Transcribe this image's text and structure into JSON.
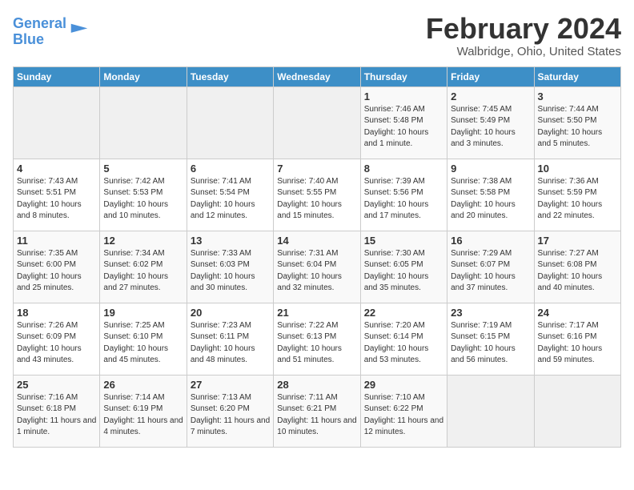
{
  "header": {
    "logo_line1": "General",
    "logo_line2": "Blue",
    "title": "February 2024",
    "subtitle": "Walbridge, Ohio, United States"
  },
  "weekdays": [
    "Sunday",
    "Monday",
    "Tuesday",
    "Wednesday",
    "Thursday",
    "Friday",
    "Saturday"
  ],
  "weeks": [
    [
      {
        "day": "",
        "info": ""
      },
      {
        "day": "",
        "info": ""
      },
      {
        "day": "",
        "info": ""
      },
      {
        "day": "",
        "info": ""
      },
      {
        "day": "1",
        "info": "Sunrise: 7:46 AM\nSunset: 5:48 PM\nDaylight: 10 hours and 1 minute."
      },
      {
        "day": "2",
        "info": "Sunrise: 7:45 AM\nSunset: 5:49 PM\nDaylight: 10 hours and 3 minutes."
      },
      {
        "day": "3",
        "info": "Sunrise: 7:44 AM\nSunset: 5:50 PM\nDaylight: 10 hours and 5 minutes."
      }
    ],
    [
      {
        "day": "4",
        "info": "Sunrise: 7:43 AM\nSunset: 5:51 PM\nDaylight: 10 hours and 8 minutes."
      },
      {
        "day": "5",
        "info": "Sunrise: 7:42 AM\nSunset: 5:53 PM\nDaylight: 10 hours and 10 minutes."
      },
      {
        "day": "6",
        "info": "Sunrise: 7:41 AM\nSunset: 5:54 PM\nDaylight: 10 hours and 12 minutes."
      },
      {
        "day": "7",
        "info": "Sunrise: 7:40 AM\nSunset: 5:55 PM\nDaylight: 10 hours and 15 minutes."
      },
      {
        "day": "8",
        "info": "Sunrise: 7:39 AM\nSunset: 5:56 PM\nDaylight: 10 hours and 17 minutes."
      },
      {
        "day": "9",
        "info": "Sunrise: 7:38 AM\nSunset: 5:58 PM\nDaylight: 10 hours and 20 minutes."
      },
      {
        "day": "10",
        "info": "Sunrise: 7:36 AM\nSunset: 5:59 PM\nDaylight: 10 hours and 22 minutes."
      }
    ],
    [
      {
        "day": "11",
        "info": "Sunrise: 7:35 AM\nSunset: 6:00 PM\nDaylight: 10 hours and 25 minutes."
      },
      {
        "day": "12",
        "info": "Sunrise: 7:34 AM\nSunset: 6:02 PM\nDaylight: 10 hours and 27 minutes."
      },
      {
        "day": "13",
        "info": "Sunrise: 7:33 AM\nSunset: 6:03 PM\nDaylight: 10 hours and 30 minutes."
      },
      {
        "day": "14",
        "info": "Sunrise: 7:31 AM\nSunset: 6:04 PM\nDaylight: 10 hours and 32 minutes."
      },
      {
        "day": "15",
        "info": "Sunrise: 7:30 AM\nSunset: 6:05 PM\nDaylight: 10 hours and 35 minutes."
      },
      {
        "day": "16",
        "info": "Sunrise: 7:29 AM\nSunset: 6:07 PM\nDaylight: 10 hours and 37 minutes."
      },
      {
        "day": "17",
        "info": "Sunrise: 7:27 AM\nSunset: 6:08 PM\nDaylight: 10 hours and 40 minutes."
      }
    ],
    [
      {
        "day": "18",
        "info": "Sunrise: 7:26 AM\nSunset: 6:09 PM\nDaylight: 10 hours and 43 minutes."
      },
      {
        "day": "19",
        "info": "Sunrise: 7:25 AM\nSunset: 6:10 PM\nDaylight: 10 hours and 45 minutes."
      },
      {
        "day": "20",
        "info": "Sunrise: 7:23 AM\nSunset: 6:11 PM\nDaylight: 10 hours and 48 minutes."
      },
      {
        "day": "21",
        "info": "Sunrise: 7:22 AM\nSunset: 6:13 PM\nDaylight: 10 hours and 51 minutes."
      },
      {
        "day": "22",
        "info": "Sunrise: 7:20 AM\nSunset: 6:14 PM\nDaylight: 10 hours and 53 minutes."
      },
      {
        "day": "23",
        "info": "Sunrise: 7:19 AM\nSunset: 6:15 PM\nDaylight: 10 hours and 56 minutes."
      },
      {
        "day": "24",
        "info": "Sunrise: 7:17 AM\nSunset: 6:16 PM\nDaylight: 10 hours and 59 minutes."
      }
    ],
    [
      {
        "day": "25",
        "info": "Sunrise: 7:16 AM\nSunset: 6:18 PM\nDaylight: 11 hours and 1 minute."
      },
      {
        "day": "26",
        "info": "Sunrise: 7:14 AM\nSunset: 6:19 PM\nDaylight: 11 hours and 4 minutes."
      },
      {
        "day": "27",
        "info": "Sunrise: 7:13 AM\nSunset: 6:20 PM\nDaylight: 11 hours and 7 minutes."
      },
      {
        "day": "28",
        "info": "Sunrise: 7:11 AM\nSunset: 6:21 PM\nDaylight: 11 hours and 10 minutes."
      },
      {
        "day": "29",
        "info": "Sunrise: 7:10 AM\nSunset: 6:22 PM\nDaylight: 11 hours and 12 minutes."
      },
      {
        "day": "",
        "info": ""
      },
      {
        "day": "",
        "info": ""
      }
    ]
  ]
}
